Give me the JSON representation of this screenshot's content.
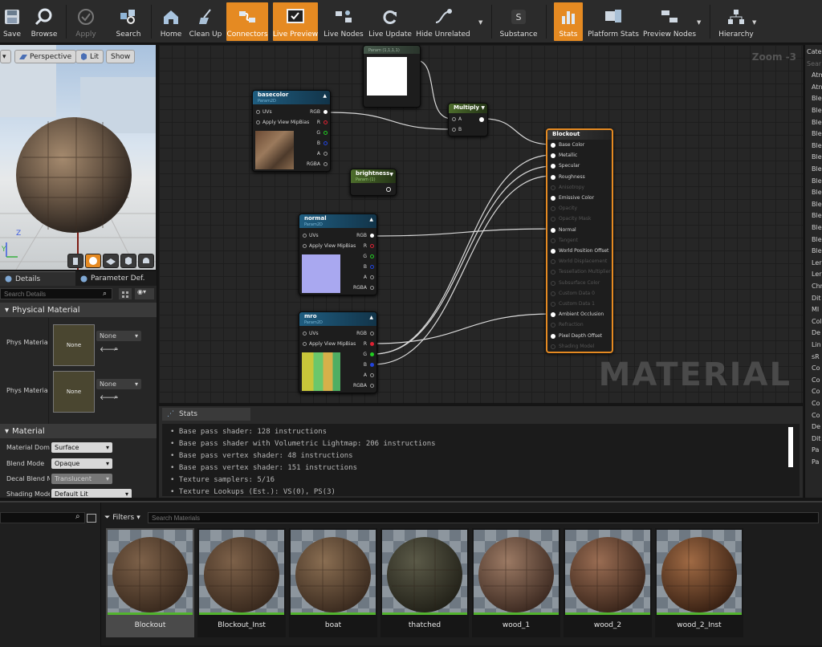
{
  "toolbar": {
    "items": [
      {
        "label": "Save"
      },
      {
        "label": "Browse"
      },
      {
        "label": "Apply"
      },
      {
        "label": "Search"
      },
      {
        "label": "Home"
      },
      {
        "label": "Clean Up"
      },
      {
        "label": "Connectors"
      },
      {
        "label": "Live Preview"
      },
      {
        "label": "Live Nodes"
      },
      {
        "label": "Live Update"
      },
      {
        "label": "Hide Unrelated"
      },
      {
        "label": "Substance"
      },
      {
        "label": "Stats"
      },
      {
        "label": "Platform Stats"
      },
      {
        "label": "Preview Nodes"
      },
      {
        "label": "Hierarchy"
      }
    ]
  },
  "viewport": {
    "perspective": "Perspective",
    "lit": "Lit",
    "show": "Show",
    "axis_z": "Z",
    "axis_y": "Y"
  },
  "details": {
    "tabs": [
      "Details",
      "Parameter Def."
    ],
    "search_placeholder": "Search Details",
    "cat_physical": "Physical Material",
    "phys_label_1": "Phys Material",
    "phys_label_2": "Phys Material",
    "none_thumb": "None",
    "none_combo": "None",
    "cat_material": "Material",
    "rows": [
      {
        "label": "Material Doma",
        "value": "Surface"
      },
      {
        "label": "Blend Mode",
        "value": "Opaque"
      },
      {
        "label": "Decal Blend M",
        "value": "Translucent"
      },
      {
        "label": "Shading Mode",
        "value": "Default Lit"
      }
    ]
  },
  "graph": {
    "zoom": "Zoom -3",
    "watermark": "MATERIAL",
    "nodes": {
      "param_top": {
        "title": "Param (1,1,1,1)"
      },
      "basecolor": {
        "title": "basecolor",
        "sub": "Param2D",
        "inputs": [
          "UVs",
          "Apply View MipBias"
        ],
        "outputs": [
          "RGB",
          "R",
          "G",
          "B",
          "A",
          "RGBA"
        ]
      },
      "multiply": {
        "title": "Multiply",
        "inputs": [
          "A",
          "B"
        ]
      },
      "brightness": {
        "title": "brightness",
        "sub": "Param (1)"
      },
      "normal": {
        "title": "normal",
        "sub": "Param2D",
        "inputs": [
          "UVs",
          "Apply View MipBias"
        ],
        "outputs": [
          "RGB",
          "R",
          "G",
          "B",
          "A",
          "RGBA"
        ]
      },
      "mro": {
        "title": "mro",
        "sub": "Param2D",
        "inputs": [
          "UVs",
          "Apply View MipBias"
        ],
        "outputs": [
          "RGB",
          "R",
          "G",
          "B",
          "A",
          "RGBA"
        ]
      },
      "blockout": {
        "title": "Blockout",
        "pins": [
          "Base Color",
          "Metallic",
          "Specular",
          "Roughness",
          "Anisotropy",
          "Emissive Color",
          "Opacity",
          "Opacity Mask",
          "Normal",
          "Tangent",
          "World Position Offset",
          "World Displacement",
          "Tessellation Multiplier",
          "Subsurface Color",
          "Custom Data 0",
          "Custom Data 1",
          "Ambient Occlusion",
          "Refraction",
          "Pixel Depth Offset",
          "Shading Model"
        ]
      }
    }
  },
  "stats": {
    "tab": "Stats",
    "lines": [
      "Base pass shader: 128 instructions",
      "Base pass shader with Volumetric Lightmap: 206 instructions",
      "Base pass vertex shader: 48 instructions",
      "Base pass vertex shader: 151 instructions",
      "Texture samplers: 5/16",
      "Texture Lookups (Est.): VS(0), PS(3)"
    ]
  },
  "palette": {
    "items": [
      "Categ",
      "Sear",
      "Atm",
      "Atn",
      "Ble",
      "Ble",
      "Ble",
      "Ble",
      "Ble",
      "Ble",
      "Ble",
      "Ble",
      "Ble",
      "Ble",
      "Ble",
      "Ble",
      "Ble",
      "Ble",
      "Ler",
      "Ler",
      "Chr",
      "Dit",
      "MI",
      "Col",
      "De",
      "Lin",
      "sR",
      "Co",
      "Co",
      "Co",
      "Co",
      "Co",
      "De",
      "Dit",
      "Pa",
      "Pa"
    ]
  },
  "browser": {
    "filters": "Filters",
    "search_placeholder": "Search Materials",
    "assets": [
      {
        "name": "Blockout"
      },
      {
        "name": "Blockout_Inst"
      },
      {
        "name": "boat"
      },
      {
        "name": "thatched"
      },
      {
        "name": "wood_1"
      },
      {
        "name": "wood_2"
      },
      {
        "name": "wood_2_Inst"
      }
    ]
  },
  "colors": {
    "accent": "#e58a22",
    "node_blue": "#1f5d80",
    "wire": "#d8d8d8",
    "thumb_bar": "#52b32e"
  }
}
